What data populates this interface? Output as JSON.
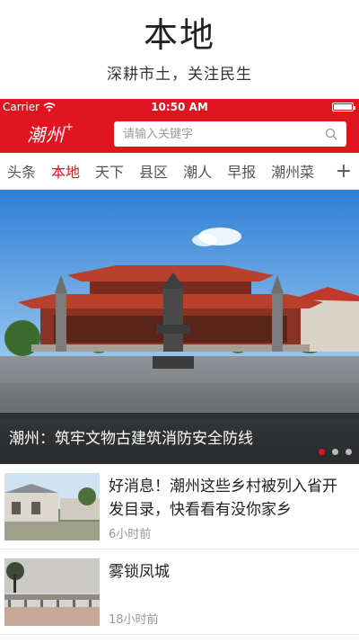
{
  "promo": {
    "title": "本地",
    "subtitle": "深耕市土，关注民生"
  },
  "status_bar": {
    "carrier": "Carrier",
    "time": "10:50 AM"
  },
  "header": {
    "logo_text": "潮州",
    "logo_plus": "+",
    "search_placeholder": "请输入关键字"
  },
  "tabs": [
    "头条",
    "本地",
    "天下",
    "县区",
    "潮人",
    "早报",
    "潮州菜"
  ],
  "tabs_active_index": 1,
  "tabs_more": "+",
  "banner": {
    "caption": "潮州：筑牢文物古建筑消防安全防线",
    "slide_count": 3,
    "active_slide": 1
  },
  "news": [
    {
      "title": "好消息！潮州这些乡村被列入省开发目录，快看看有没你家乡",
      "time": "6小时前"
    },
    {
      "title": "雾锁凤城",
      "time": "18小时前"
    }
  ],
  "colors": {
    "brand_red": "#e0151f",
    "tab_text": "#555555",
    "time_text": "#999999"
  }
}
